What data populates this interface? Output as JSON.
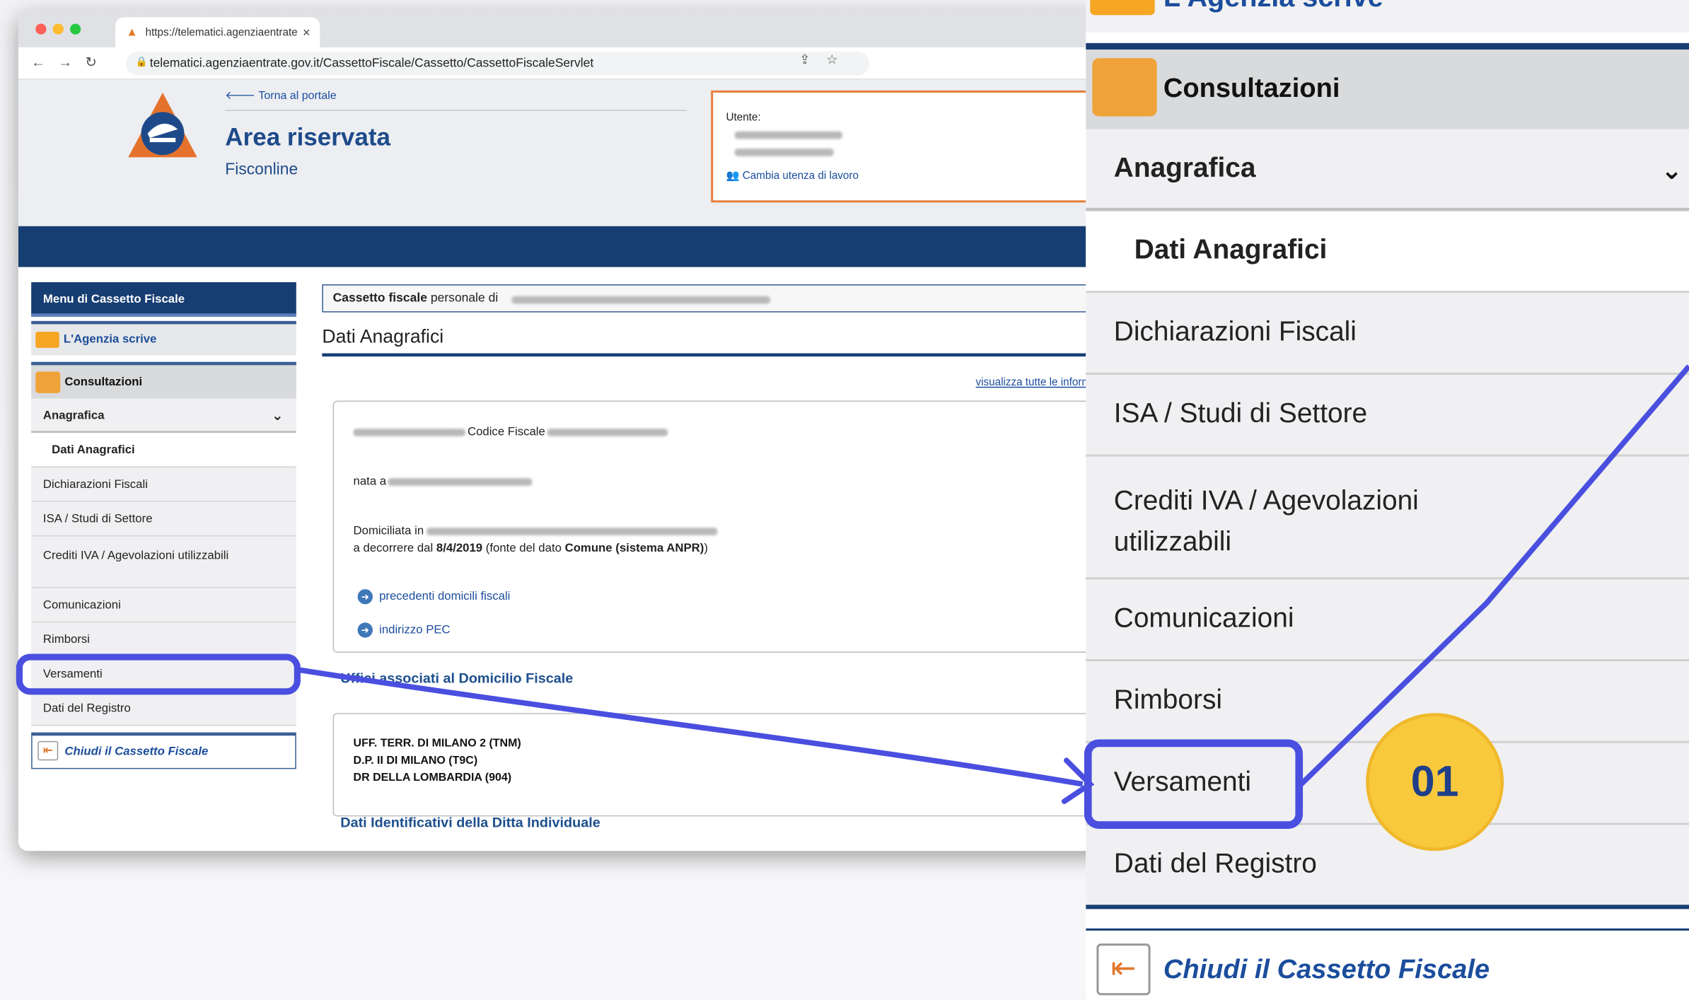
{
  "browser": {
    "tab_title": "https://telematici.agenziaentrate",
    "url": "telematici.agenziaentrate.gov.it/CassettoFiscale/Cassetto/CassettoFiscaleServlet"
  },
  "header": {
    "back_link": "Torna al portale",
    "title": "Area riservata",
    "subtitle": "Fisconline",
    "user_label": "Utente:",
    "change_user": "Cambia utenza di lavoro"
  },
  "menu": {
    "title": "Menu di Cassetto Fiscale",
    "agenzia": "L'Agenzia scrive",
    "consultazioni": "Consultazioni",
    "anagrafica": "Anagrafica",
    "dati_anagrafici": "Dati Anagrafici",
    "items": [
      "Dichiarazioni Fiscali",
      "ISA / Studi di Settore",
      "Crediti IVA / Agevolazioni utilizzabili",
      "Comunicazioni",
      "Rimborsi",
      "Versamenti",
      "Dati del Registro"
    ],
    "close": "Chiudi il Cassetto Fiscale"
  },
  "content": {
    "cassetto_bold": "Cassetto fiscale",
    "cassetto_rest": "personale di",
    "section_title": "Dati Anagrafici",
    "info_link": "visualizza tutte le informazioni a",
    "codice_fiscale": "Codice Fiscale",
    "nata_a": "nata a",
    "domiciliata": "Domiciliata in",
    "decorrere_pre": "a decorrere dal",
    "decorrere_date": "8/4/2019",
    "decorrere_mid": "(fonte del dato",
    "decorrere_source": "Comune (sistema ANPR)",
    "decorrere_end": ")",
    "link_domicili": "precedenti domicili fiscali",
    "link_pec": "indirizzo PEC",
    "uffici_title": "Uffici associati al Domicilio Fiscale",
    "uffici": [
      "UFF. TERR. DI MILANO 2 (TNM)",
      "D.P. II DI MILANO (T9C)",
      "DR DELLA LOMBARDIA (904)"
    ],
    "ditta_title": "Dati Identificativi della Ditta Individuale"
  },
  "zoom": {
    "agenzia": "L'Agenzia scrive",
    "consultazioni": "Consultazioni",
    "anagrafica": "Anagrafica",
    "dati_anagrafici": "Dati Anagrafici",
    "dichiarazioni": "Dichiarazioni Fiscali",
    "isa": "ISA / Studi di Settore",
    "crediti_1": "Crediti IVA / Agevolazioni",
    "crediti_2": "utilizzabili",
    "comunicazioni": "Comunicazioni",
    "rimborsi": "Rimborsi",
    "versamenti": "Versamenti",
    "registro": "Dati del Registro",
    "close": "Chiudi il Cassetto Fiscale"
  },
  "annotation": {
    "step": "01",
    "color": "#4a4fe0",
    "badge_color": "#f8c93c"
  }
}
